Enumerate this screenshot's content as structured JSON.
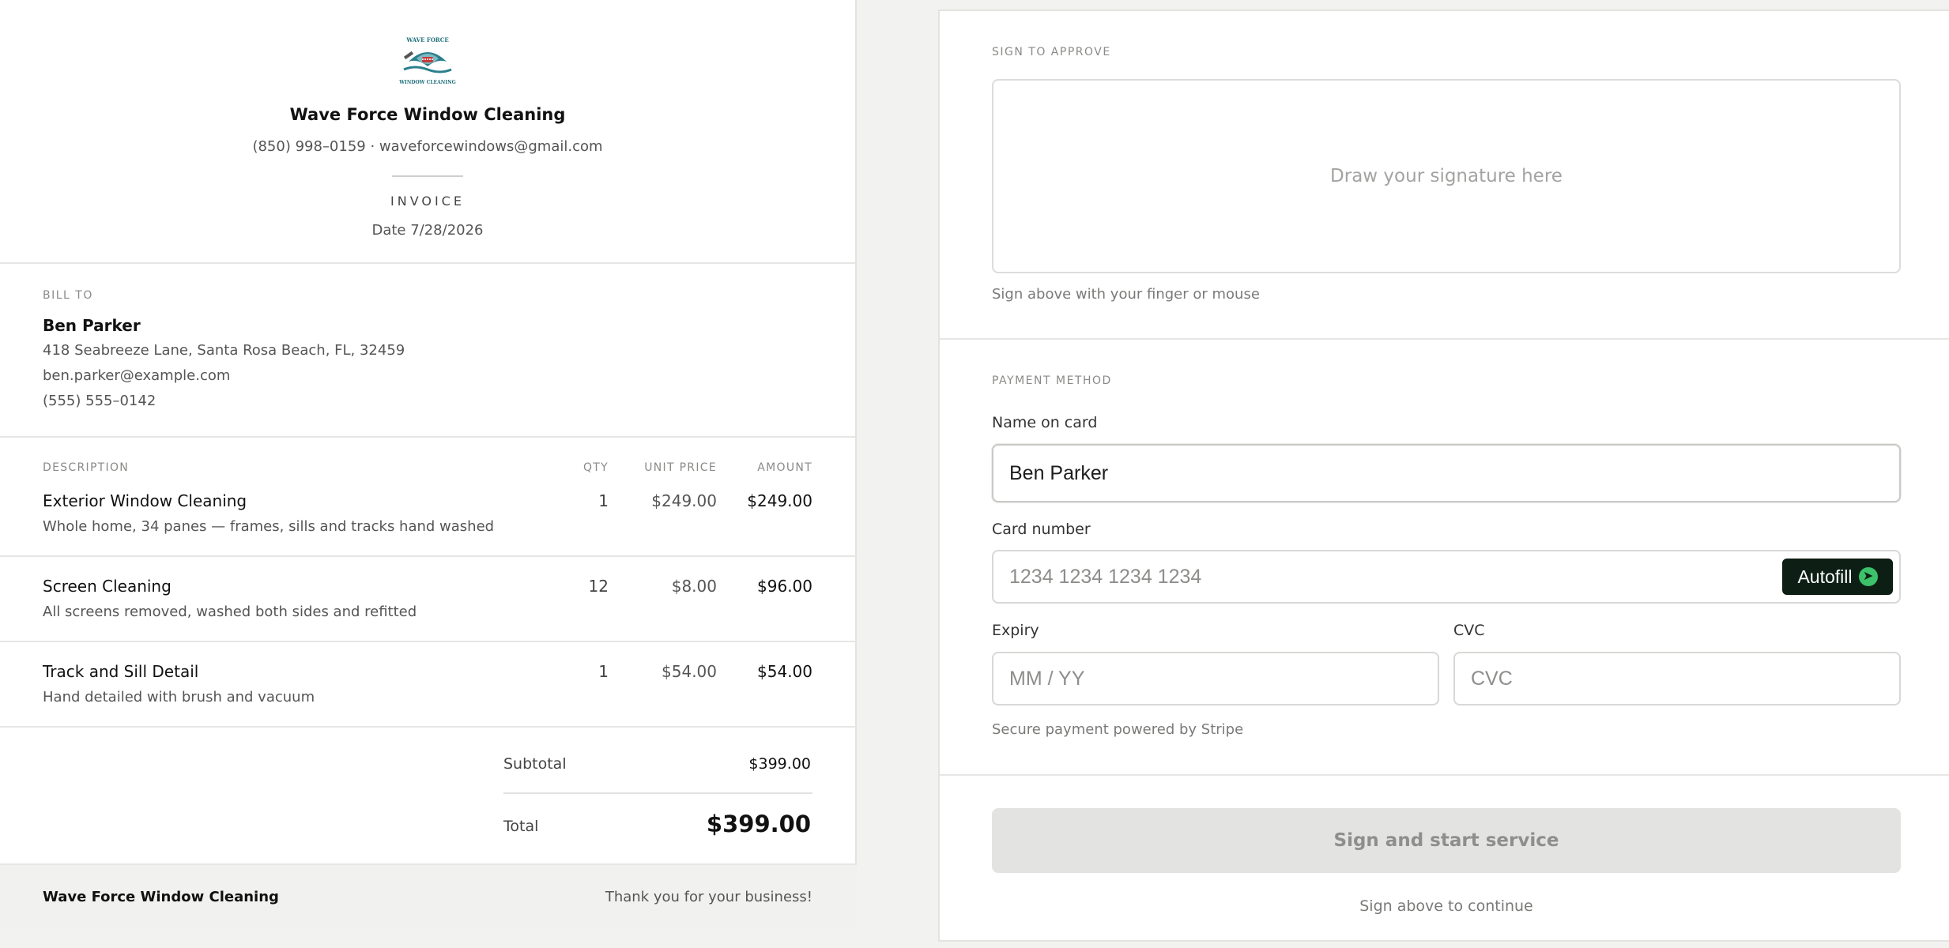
{
  "invoice": {
    "logo": {
      "icon": "shark-window-cleaner-logo",
      "text": "WAVE FORCE WINDOW CLEANING"
    },
    "company_name": "Wave Force Window Cleaning",
    "contact": "(850) 998–0159 · waveforcewindows@gmail.com",
    "doc_label": "INVOICE",
    "date": "Date 7/28/2026",
    "bill_to": {
      "label": "BILL TO",
      "name": "Ben Parker",
      "address": "418 Seabreeze Lane, Santa Rosa Beach, FL, 32459",
      "email": "ben.parker@example.com",
      "phone": "(555) 555–0142"
    },
    "columns": {
      "description": "DESCRIPTION",
      "qty": "QTY",
      "unit_price": "UNIT PRICE",
      "amount": "AMOUNT"
    },
    "items": [
      {
        "title": "Exterior Window Cleaning",
        "desc": "Whole home, 34 panes — frames, sills and tracks hand washed",
        "qty": "1",
        "unit": "$249.00",
        "amount": "$249.00"
      },
      {
        "title": "Screen Cleaning",
        "desc": "All screens removed, washed both sides and refitted",
        "qty": "12",
        "unit": "$8.00",
        "amount": "$96.00"
      },
      {
        "title": "Track and Sill Detail",
        "desc": "Hand detailed with brush and vacuum",
        "qty": "1",
        "unit": "$54.00",
        "amount": "$54.00"
      }
    ],
    "subtotal_label": "Subtotal",
    "subtotal": "$399.00",
    "total_label": "Total",
    "total": "$399.00",
    "footer_name": "Wave Force Window Cleaning",
    "footer_thanks": "Thank you for your business!"
  },
  "sign": {
    "label": "SIGN TO APPROVE",
    "pad_placeholder": "Draw your signature here",
    "hint": "Sign above with your finger or mouse"
  },
  "payment": {
    "label": "PAYMENT METHOD",
    "name_label": "Name on card",
    "name_value": "Ben Parker",
    "card_label": "Card number",
    "card_placeholder": "1234 1234 1234 1234",
    "autofill_label": "Autofill",
    "autofill_icon": "arrow-right-circle-icon",
    "expiry_label": "Expiry",
    "expiry_placeholder": "MM / YY",
    "cvc_label": "CVC",
    "cvc_placeholder": "CVC",
    "secure_note": "Secure payment powered by Stripe"
  },
  "actions": {
    "submit_label": "Sign and start service",
    "continue_hint": "Sign above to continue"
  },
  "colors": {
    "autofill_bg": "#0d1f14",
    "autofill_icon": "#3cc26a",
    "disabled_button": "#e3e3e1"
  }
}
